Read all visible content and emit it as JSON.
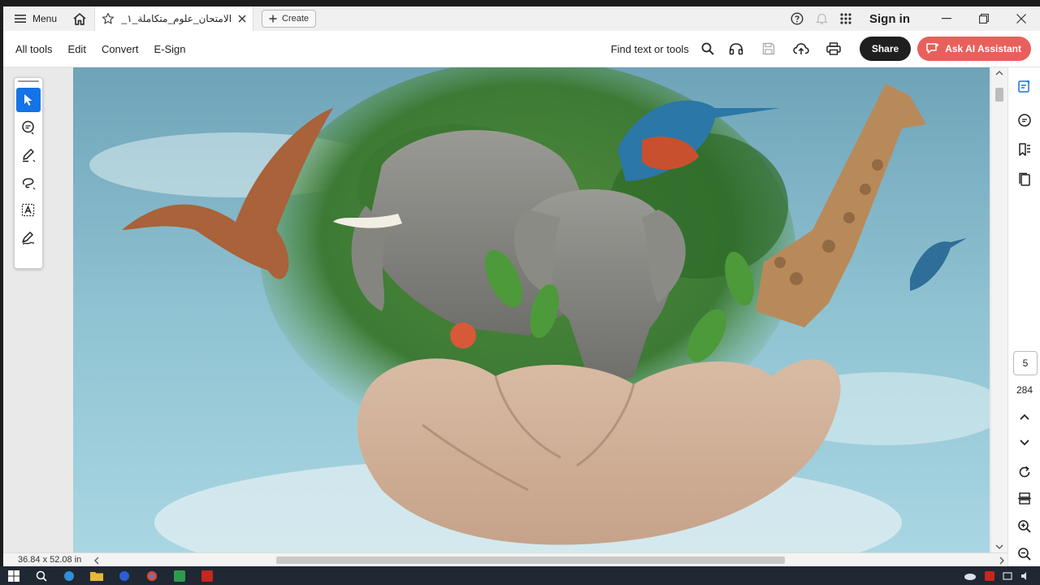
{
  "app": {
    "menu_label": "Menu",
    "tab_title": "الامتحان_علوم_متكاملة_١_ثا..",
    "create_label": "Create",
    "sign_in_label": "Sign in"
  },
  "toolbar": {
    "items": [
      "All tools",
      "Edit",
      "Convert",
      "E-Sign"
    ],
    "find_label": "Find text or tools",
    "share_label": "Share",
    "ai_label": "Ask AI Assistant"
  },
  "navigation": {
    "current_page": "5",
    "total_pages": "284"
  },
  "status": {
    "page_dimensions": "36.84 x 52.08 in"
  },
  "icons": {
    "menu": "hamburger-icon",
    "home": "home-icon",
    "favorite": "star-icon",
    "close_tab": "close-icon",
    "create": "plus-icon",
    "help": "help-icon",
    "notifications": "bell-icon",
    "apps": "apps-grid-icon",
    "search": "search-icon",
    "read_aloud": "headphones-icon",
    "save": "save-icon",
    "upload": "cloud-upload-icon",
    "print": "print-icon"
  },
  "colors": {
    "accent_blue": "#1473e6",
    "ai_button": "#e8605c",
    "share_button": "#1f1f1f"
  }
}
